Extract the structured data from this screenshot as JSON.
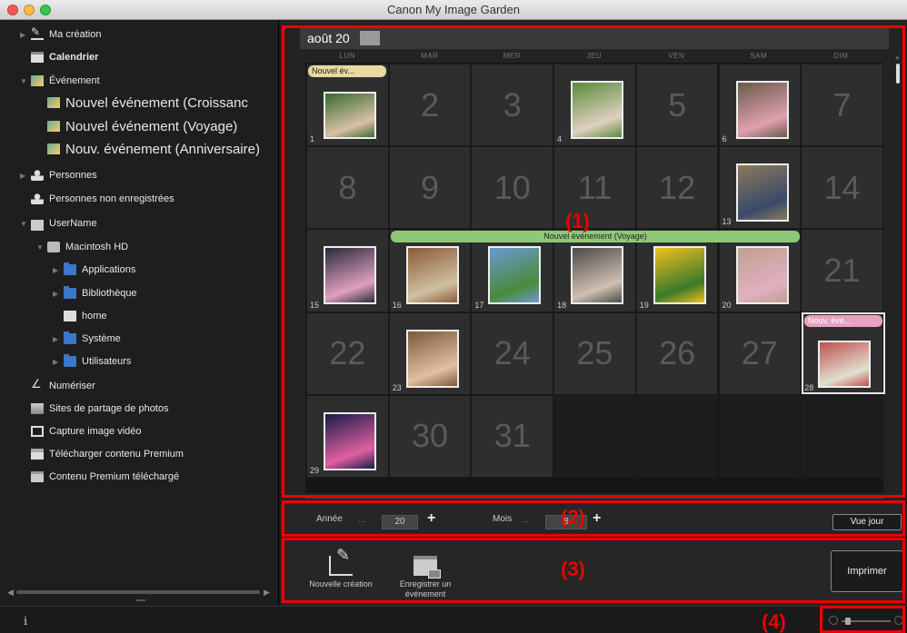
{
  "window": {
    "title": "Canon My Image Garden"
  },
  "sidebar": {
    "items": [
      {
        "label": "Ma création",
        "icon": "pencil-icon",
        "icon_class": "ico-pencil",
        "indent": 0,
        "triangle": "▶",
        "size": "t-sm",
        "bold": false
      },
      {
        "label": "Calendrier",
        "icon": "calendar-icon",
        "icon_class": "ico-cal",
        "indent": 0,
        "triangle": "",
        "size": "t-sm",
        "bold": true
      },
      {
        "label": "Événement",
        "icon": "event-icon",
        "icon_class": "ico-photo",
        "indent": 0,
        "triangle": "▼",
        "size": "t-sm",
        "bold": false
      },
      {
        "label": "Nouvel événement (Croissanc",
        "icon": "event-photo-icon",
        "icon_class": "ico-photo",
        "indent": 1,
        "triangle": "",
        "size": "t-lg",
        "bold": false
      },
      {
        "label": "Nouvel événement (Voyage)",
        "icon": "event-photo-icon",
        "icon_class": "ico-photo",
        "indent": 1,
        "triangle": "",
        "size": "t-lg",
        "bold": false
      },
      {
        "label": "Nouv. événement (Anniversaire)",
        "icon": "event-photo-icon",
        "icon_class": "ico-photo",
        "indent": 1,
        "triangle": "",
        "size": "t-lg",
        "bold": false
      },
      {
        "label": "Personnes",
        "icon": "person-icon",
        "icon_class": "ico-person",
        "indent": 0,
        "triangle": "▶",
        "size": "t-sm",
        "bold": false
      },
      {
        "label": "Personnes non enregistrées",
        "icon": "unregistered-person-icon",
        "icon_class": "ico-person",
        "indent": 0,
        "triangle": "",
        "size": "t-sm",
        "bold": false
      },
      {
        "label": "UserName",
        "icon": "user-icon",
        "icon_class": "ico-user",
        "indent": 0,
        "triangle": "▼",
        "size": "t-sm",
        "bold": false
      },
      {
        "label": "Macintosh HD",
        "icon": "disk-icon",
        "icon_class": "ico-disk",
        "indent": 1,
        "triangle": "▼",
        "size": "t-sm",
        "bold": false
      },
      {
        "label": "Applications",
        "icon": "folder-icon",
        "icon_class": "ico-folder",
        "indent": 2,
        "triangle": "▶",
        "size": "t-sm",
        "bold": false
      },
      {
        "label": "Bibliothèque",
        "icon": "folder-icon",
        "icon_class": "ico-folder",
        "indent": 2,
        "triangle": "▶",
        "size": "t-sm",
        "bold": false
      },
      {
        "label": "home",
        "icon": "home-folder-icon",
        "icon_class": "ico-doc",
        "indent": 2,
        "triangle": "",
        "size": "t-sm",
        "bold": false
      },
      {
        "label": "Système",
        "icon": "folder-icon",
        "icon_class": "ico-folder",
        "indent": 2,
        "triangle": "▶",
        "size": "t-sm",
        "bold": false
      },
      {
        "label": "Utilisateurs",
        "icon": "folder-icon",
        "icon_class": "ico-folder",
        "indent": 2,
        "triangle": "▶",
        "size": "t-sm",
        "bold": false
      },
      {
        "label": "Numériser",
        "icon": "scan-icon",
        "icon_class": "ico-scan",
        "indent": 0,
        "triangle": "",
        "size": "t-sm",
        "bold": false
      },
      {
        "label": "Sites de partage de photos",
        "icon": "share-icon",
        "icon_class": "ico-share",
        "indent": 0,
        "triangle": "",
        "size": "t-sm",
        "bold": false
      },
      {
        "label": "Capture image vidéo",
        "icon": "video-capture-icon",
        "icon_class": "ico-video",
        "indent": 0,
        "triangle": "",
        "size": "t-sm",
        "bold": false
      },
      {
        "label": "Télécharger contenu Premium",
        "icon": "download-icon",
        "icon_class": "ico-dl",
        "indent": 0,
        "triangle": "",
        "size": "t-sm",
        "bold": false
      },
      {
        "label": "Contenu Premium téléchargé",
        "icon": "premium-box-icon",
        "icon_class": "ico-box",
        "indent": 0,
        "triangle": "",
        "size": "t-sm",
        "bold": false
      }
    ]
  },
  "calendar": {
    "month_label": "août 20",
    "weekdays": [
      "LUN",
      "MAR",
      "MER",
      "JEU",
      "VEN",
      "SAM",
      "DIM"
    ],
    "days": [
      {
        "day": "1",
        "photo": true,
        "colors": [
          "#3a6a2a",
          "#d8c0a8"
        ]
      },
      {
        "day": "2",
        "photo": false
      },
      {
        "day": "3",
        "photo": false
      },
      {
        "day": "4",
        "photo": true,
        "colors": [
          "#5a8a3a",
          "#e0d0c0"
        ]
      },
      {
        "day": "5",
        "photo": false
      },
      {
        "day": "6",
        "photo": true,
        "colors": [
          "#6a5a4a",
          "#e0a0b0"
        ]
      },
      {
        "day": "7",
        "photo": false
      },
      {
        "day": "8",
        "photo": false
      },
      {
        "day": "9",
        "photo": false
      },
      {
        "day": "10",
        "photo": false
      },
      {
        "day": "11",
        "photo": false
      },
      {
        "day": "12",
        "photo": false
      },
      {
        "day": "13",
        "photo": true,
        "colors": [
          "#8a7a5a",
          "#3a4a6a"
        ]
      },
      {
        "day": "14",
        "photo": false
      },
      {
        "day": "15",
        "photo": true,
        "colors": [
          "#2a2a3a",
          "#e0a0c0"
        ]
      },
      {
        "day": "16",
        "photo": true,
        "colors": [
          "#8a5a3a",
          "#d0c0a0"
        ]
      },
      {
        "day": "17",
        "photo": true,
        "colors": [
          "#6a9ad0",
          "#4a8a3a"
        ]
      },
      {
        "day": "18",
        "photo": true,
        "colors": [
          "#4a4a4a",
          "#d0c0b0"
        ]
      },
      {
        "day": "19",
        "photo": true,
        "colors": [
          "#f0c020",
          "#3a7a2a"
        ]
      },
      {
        "day": "20",
        "photo": true,
        "colors": [
          "#c0a090",
          "#e0b0c0"
        ]
      },
      {
        "day": "21",
        "photo": false
      },
      {
        "day": "22",
        "photo": false
      },
      {
        "day": "23",
        "photo": true,
        "colors": [
          "#7a5a3a",
          "#e0c0a0"
        ]
      },
      {
        "day": "24",
        "photo": false
      },
      {
        "day": "25",
        "photo": false
      },
      {
        "day": "26",
        "photo": false
      },
      {
        "day": "27",
        "photo": false
      },
      {
        "day": "28",
        "photo": true,
        "colors": [
          "#c05050",
          "#e0e0d0"
        ]
      },
      {
        "day": "29",
        "photo": true,
        "colors": [
          "#1a1a4a",
          "#e060a0"
        ]
      },
      {
        "day": "30",
        "photo": false
      },
      {
        "day": "31",
        "photo": false
      }
    ],
    "events": {
      "day1": "Nouvel év...",
      "voyage": "Nouvel événement (Voyage)",
      "day28": "Nouv. évé..."
    }
  },
  "controls": {
    "year_label": "Année",
    "year_value": "20",
    "month_label": "Mois",
    "month_value": "8",
    "dots": "...",
    "plus": "+",
    "day_view_button": "Vue jour"
  },
  "toolbar": {
    "new_creation": "Nouvelle création",
    "register_event": "Enregistrer un événement",
    "print_button": "Imprimer"
  },
  "status": {
    "info": "i"
  },
  "annotations": [
    "(1)",
    "(2)",
    "(3)",
    "(4)"
  ],
  "colors": {
    "annotation_red": "#e00000",
    "event_yellow": "#e8d9a0",
    "event_green": "#8fc878",
    "event_pink": "#e8a0c0"
  }
}
